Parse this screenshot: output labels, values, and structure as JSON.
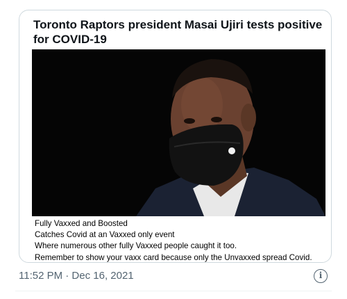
{
  "tweet": {
    "card": {
      "headline": "Toronto Raptors president Masai Ujiri tests positive for COVID-19"
    },
    "caption_lines": [
      "Fully Vaxxed and Boosted",
      "Catches Covid at an Vaxxed only event",
      "Where numerous other fully Vaxxed people caught it too.",
      "Remember to show your vaxx card because only the Unvaxxed spread Covid."
    ],
    "timestamp": "11:52 PM · Dec 16, 2021",
    "info_icon": "info-circle-icon",
    "info_glyph": "i"
  },
  "colors": {
    "border": "#cfd9de",
    "muted_text": "#536471",
    "photo_bg": "#050505"
  }
}
